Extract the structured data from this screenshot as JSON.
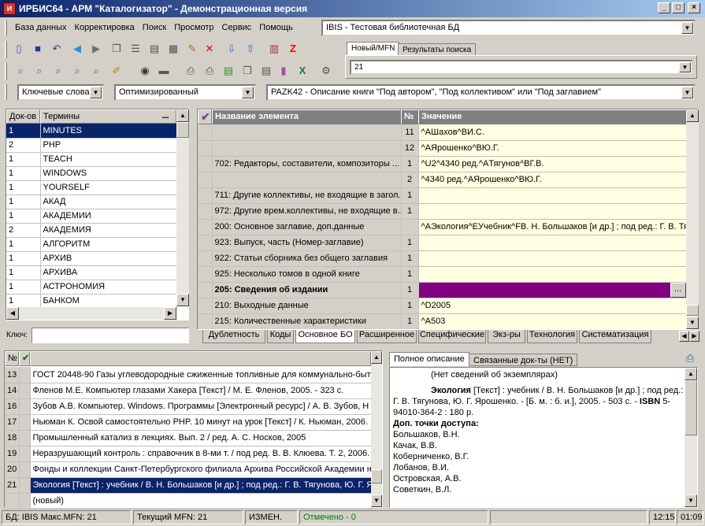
{
  "window": {
    "title": "ИРБИС64 - АРМ \"Каталогизатор\" - Демонстрационная версия",
    "app_icon": "irbis-icon"
  },
  "menu": [
    "База данных",
    "Корректировка",
    "Поиск",
    "Просмотр",
    "Сервис",
    "Помощь"
  ],
  "db_select": {
    "value": "IBIS - Тестовая библиотечная БД"
  },
  "mfn_tabs": [
    "Новый/MFN",
    "Результаты поиска"
  ],
  "mfn_field": {
    "value": "21"
  },
  "search_bar": {
    "dictionary": "Ключевые слова",
    "mode": "Оптимизированный",
    "worksheet": "PAZK42 - Описание книги \"Под автором\", \"Под коллективом\" или \"Под заглавием\""
  },
  "dictionary": {
    "headers": [
      "Док-ов",
      "Термины"
    ],
    "rows": [
      [
        "1",
        "MINUTES"
      ],
      [
        "2",
        "PHP"
      ],
      [
        "1",
        "TEACH"
      ],
      [
        "1",
        "WINDOWS"
      ],
      [
        "1",
        "YOURSELF"
      ],
      [
        "1",
        "АКАД"
      ],
      [
        "1",
        "АКАДЕМИИ"
      ],
      [
        "2",
        "АКАДЕМИЯ"
      ],
      [
        "1",
        "АЛГОРИТМ"
      ],
      [
        "1",
        "АРХИВ"
      ],
      [
        "1",
        "АРХИВА"
      ],
      [
        "1",
        "АСТРОНОМИЯ"
      ],
      [
        "1",
        "БАНКОМ"
      ]
    ],
    "key_label": "Ключ:"
  },
  "editor": {
    "headers": [
      "Название элемента",
      "№",
      "Значение"
    ],
    "rows": [
      {
        "name": "",
        "num": "11",
        "value": "^AШахов^BИ.С."
      },
      {
        "name": "",
        "num": "12",
        "value": "^AЯрошенко^BЮ.Г."
      },
      {
        "name": "702: Редакторы, составители, композиторы ...",
        "num": "1",
        "value": "^U2^4340 ред.^AТягунов^BГ.В."
      },
      {
        "name": "",
        "num": "2",
        "value": "^4340 ред.^AЯрошенко^BЮ.Г."
      },
      {
        "name": "711: Другие коллективы, не входящие в загол...",
        "num": "1",
        "value": ""
      },
      {
        "name": "972: Другие врем.коллективы, не входящие в...",
        "num": "1",
        "value": ""
      },
      {
        "name": "200: Основное заглавие, доп.данные",
        "num": "",
        "value": "^AЭкология^EУчебник^FВ. Н. Большаков [и др.] ; под ред.: Г. В. Тяг"
      },
      {
        "name": "923: Выпуск, часть (Номер-заглавие)",
        "num": "1",
        "value": ""
      },
      {
        "name": "922: Статьи сборника без общего заглавия",
        "num": "1",
        "value": ""
      },
      {
        "name": "925: Несколько томов в одной книге",
        "num": "1",
        "value": ""
      },
      {
        "name": "205: Сведения об издании",
        "num": "1",
        "value": ""
      },
      {
        "name": "210: Выходные данные",
        "num": "1",
        "value": "^D2005"
      },
      {
        "name": "215: Количественные характеристики",
        "num": "1",
        "value": "^A503"
      }
    ],
    "tabs": [
      "Дублетность",
      "Коды",
      "Основное БО",
      "Расширенное",
      "Специфические",
      "Экз-ры",
      "Технология",
      "Систематизация"
    ],
    "ellipsis": "..."
  },
  "records": {
    "headers": [
      "№"
    ],
    "rows": [
      [
        "13",
        "ГОСТ 20448-90 Газы углеводородные сжиженные топливные для коммунально-быт"
      ],
      [
        "14",
        "Фленов М.Е. Компьютер глазами Хакера [Текст] / М. Е. Фленов, 2005. - 323 с."
      ],
      [
        "16",
        "Зубов А.В. Компьютер. Windows. Программы [Электронный ресурс] / А. В. Зубов, Н"
      ],
      [
        "17",
        "Ньюман К. Освой самостоятельно PHP. 10 минут на урок [Текст] / К. Ньюман, 2006."
      ],
      [
        "18",
        "Промышленный катализ в лекциях. Вып. 2 / ред. А. С. Носков, 2005"
      ],
      [
        "19",
        "Неразрушающий контроль : справочник в 8-ми т. / под ред. В. В. Клюева. Т. 2, 2006."
      ],
      [
        "20",
        "Фонды и коллекции Санкт-Петербургского филиала Архива Российской Академии н"
      ],
      [
        "21",
        "Экология [Текст] : учебник / В. Н. Большаков [и др.] ; под ред.: Г. В. Тягунова, Ю. Г. Я"
      ],
      [
        "",
        "(новый)"
      ]
    ]
  },
  "description": {
    "tabs": [
      "Полное описание",
      "Связанные док-ты (НЕТ)"
    ],
    "no_copies": "(Нет сведений об экземплярах)",
    "title_bold": "Экология",
    "text1": " [Текст] : учебник / В. Н. Большаков [и др.] ; под ред.: Г. В. Тягунова, Ю. Г. Ярошенко. - [Б. м. : б. и.], 2005. - 503 с. - ",
    "isbn_bold": "ISBN",
    "text2": " 5-94010-364-2 : 180 р.",
    "access_label": "Доп. точки доступа:",
    "persons": [
      "Большаков, В.Н.",
      "Качак, В.В.",
      "Коберниченко, В.Г.",
      "Лобанов, В.И.",
      "Островская, А.В.",
      "Советкин, В.Л."
    ]
  },
  "status": {
    "db": "БД: IBIS Макс.MFN: 21",
    "current": "Текущий MFN: 21",
    "changed": "ИЗМЕН.",
    "marked": "Отмечено - 0",
    "time1": "12:15",
    "time2": "01:09"
  },
  "colors": {
    "selection": "#0a246a",
    "value_cell": "#ffffe1",
    "active_row": "#800080",
    "marked": "#008000"
  }
}
